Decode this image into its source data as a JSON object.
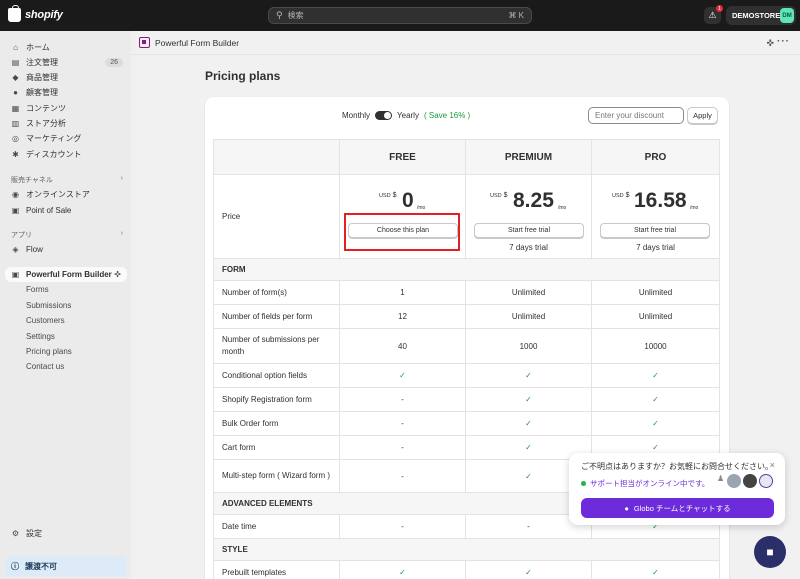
{
  "topbar": {
    "brand": "shopify",
    "search_placeholder": "検索",
    "search_shortcut": "⌘ K",
    "notification_count": "1",
    "store_name": "DEMOSTORE",
    "store_avatar": "DM"
  },
  "sidebar": {
    "items": [
      {
        "label": "ホーム",
        "icon": "home-icon",
        "glyph": "⌂"
      },
      {
        "label": "注文管理",
        "icon": "orders-icon",
        "glyph": "▤",
        "badge": "26"
      },
      {
        "label": "商品管理",
        "icon": "tag-icon",
        "glyph": "◆"
      },
      {
        "label": "顧客管理",
        "icon": "person-icon",
        "glyph": "●"
      },
      {
        "label": "コンテンツ",
        "icon": "content-icon",
        "glyph": "▦"
      },
      {
        "label": "ストア分析",
        "icon": "analytics-icon",
        "glyph": "▥"
      },
      {
        "label": "マーケティング",
        "icon": "target-icon",
        "glyph": "◎"
      },
      {
        "label": "ディスカウント",
        "icon": "discount-icon",
        "glyph": "✱"
      }
    ],
    "sales_channels_title": "販売チャネル",
    "sales_channels": [
      {
        "label": "オンラインストア",
        "icon": "store-icon",
        "glyph": "◉"
      },
      {
        "label": "Point of Sale",
        "icon": "pos-icon",
        "glyph": "▣"
      }
    ],
    "apps_title": "アプリ",
    "apps": [
      {
        "label": "Flow",
        "icon": "flow-icon",
        "glyph": "◈"
      }
    ],
    "current_app": {
      "label": "Powerful Form Builder",
      "icon": "form-builder-icon",
      "glyph": "▣"
    },
    "app_subitems": [
      "Forms",
      "Submissions",
      "Customers",
      "Settings",
      "Pricing plans",
      "Contact us"
    ],
    "settings": {
      "label": "設定",
      "glyph": "⚙"
    },
    "transfer_note": {
      "label": "譲渡不可",
      "glyph": "ⓘ"
    }
  },
  "appbar": {
    "title": "Powerful Form Builder"
  },
  "page": {
    "title": "Pricing plans"
  },
  "billing": {
    "monthly": "Monthly",
    "yearly": "Yearly",
    "save": "( Save 16% )",
    "discount_placeholder": "Enter your discount",
    "apply": "Apply"
  },
  "plans": [
    {
      "name": "FREE",
      "currency": "USD",
      "symbol": "$",
      "price": "0",
      "unit": "/mo",
      "button": "Choose this plan",
      "trial": ""
    },
    {
      "name": "PREMIUM",
      "currency": "USD",
      "symbol": "$",
      "price": "8.25",
      "unit": "/mo",
      "button": "Start free trial",
      "trial": "7 days trial"
    },
    {
      "name": "PRO",
      "currency": "USD",
      "symbol": "$",
      "price": "16.58",
      "unit": "/mo",
      "button": "Start free trial",
      "trial": "7 days trial"
    }
  ],
  "price_label": "Price",
  "sections": [
    {
      "title": "FORM",
      "rows": [
        {
          "label": "Number of form(s)",
          "values": [
            "1",
            "Unlimited",
            "Unlimited"
          ]
        },
        {
          "label": "Number of fields per form",
          "values": [
            "12",
            "Unlimited",
            "Unlimited"
          ]
        },
        {
          "label": "Number of submissions per month",
          "values": [
            "40",
            "1000",
            "10000"
          ]
        },
        {
          "label": "Conditional option fields",
          "values": [
            "✓",
            "✓",
            "✓"
          ]
        },
        {
          "label": "Shopify Registration form",
          "values": [
            "-",
            "✓",
            "✓"
          ]
        },
        {
          "label": "Bulk Order form",
          "values": [
            "-",
            "✓",
            "✓"
          ]
        },
        {
          "label": "Cart form",
          "values": [
            "-",
            "✓",
            "✓"
          ]
        },
        {
          "label": "Multi-step form ( Wizard form )",
          "values": [
            "-",
            "✓",
            "✓"
          ]
        }
      ]
    },
    {
      "title": "ADVANCED ELEMENTS",
      "rows": [
        {
          "label": "Date time",
          "values": [
            "-",
            "-",
            "✓"
          ]
        }
      ]
    },
    {
      "title": "STYLE",
      "rows": [
        {
          "label": "Prebuilt templates",
          "values": [
            "✓",
            "✓",
            "✓"
          ]
        }
      ]
    }
  ],
  "chat": {
    "question": "ご不明点はありますか？お気軽にお問合せください。",
    "online": "サポート担当がオンライン中です。",
    "button": "Globo チームとチャットする",
    "close": "×"
  }
}
